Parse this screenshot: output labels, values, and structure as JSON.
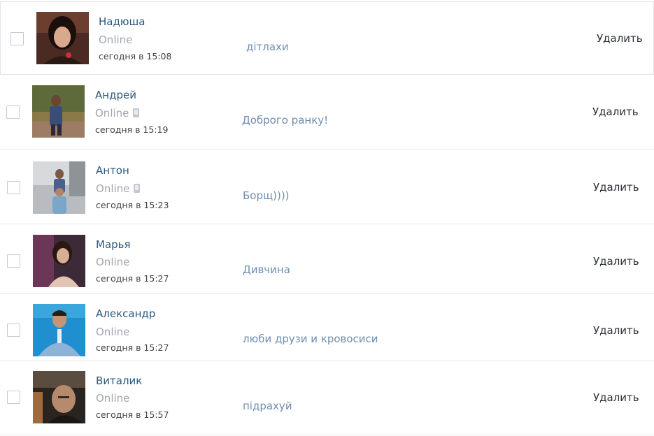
{
  "dialogs": [
    {
      "name": "Надюша",
      "status": "Online",
      "mobile": false,
      "time": "сегодня в 15:08",
      "message": "дітлахи",
      "delete_label": "Удалить"
    },
    {
      "name": "Андрей",
      "status": "Online",
      "mobile": true,
      "time": "сегодня в 15:19",
      "message": "Доброго ранку!",
      "delete_label": "Удалить"
    },
    {
      "name": "Антон",
      "status": "Online",
      "mobile": true,
      "time": "сегодня в 15:23",
      "message": "Борщ))))",
      "delete_label": "Удалить"
    },
    {
      "name": "Марья",
      "status": "Online",
      "mobile": false,
      "time": "сегодня в 15:27",
      "message": "Дивчина",
      "delete_label": "Удалить"
    },
    {
      "name": "Александр",
      "status": "Online",
      "mobile": false,
      "time": "сегодня в 15:27",
      "message": "люби друзи и кровосиси",
      "delete_label": "Удалить"
    },
    {
      "name": "Виталик",
      "status": "Online",
      "mobile": false,
      "time": "сегодня в 15:57",
      "message": "підрахуй",
      "delete_label": "Удалить"
    }
  ]
}
